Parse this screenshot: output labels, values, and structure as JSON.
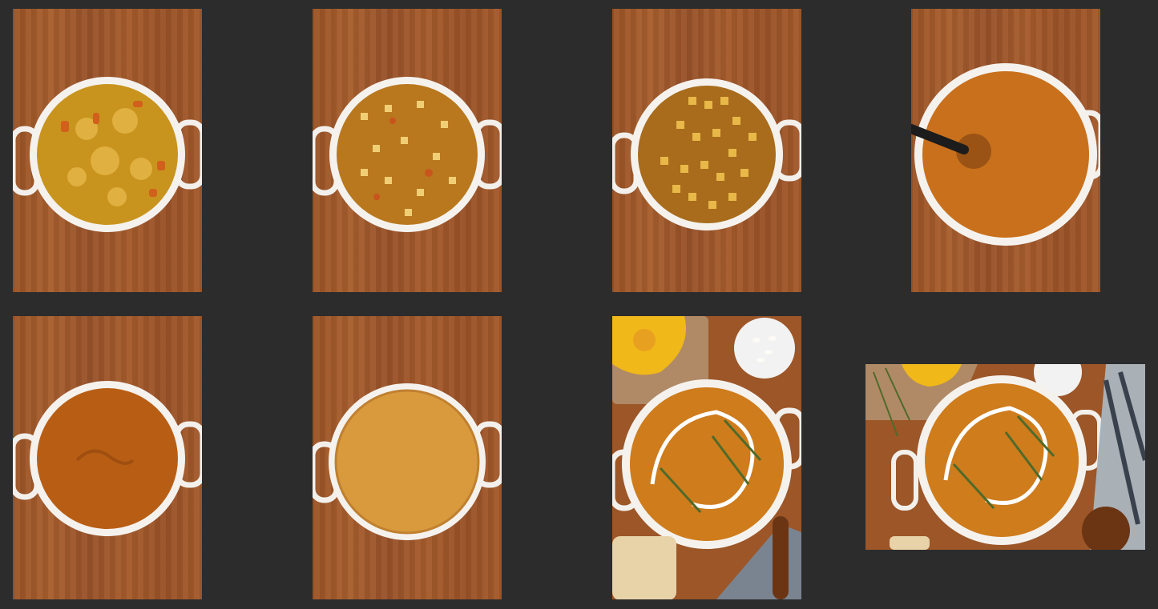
{
  "gallery": {
    "images": [
      {
        "step": "sauteed-vegetables",
        "soup_color": "#c8941e",
        "chunk_color": "#e0b040",
        "accent_color": "#d0601c"
      },
      {
        "step": "broth-with-squash-cubes",
        "soup_color": "#b9781e",
        "chunk_color": "#f0cf74",
        "accent_color": "#c9541c"
      },
      {
        "step": "simmered-squash-cubes",
        "soup_color": "#a86c1c",
        "chunk_color": "#e8b848",
        "accent_color": "#c05a1e"
      },
      {
        "step": "immersion-blender-puree",
        "soup_color": "#c9701c",
        "chunk_color": "",
        "accent_color": "#8a4a12"
      },
      {
        "step": "pureed-soup",
        "soup_color": "#b85e14",
        "chunk_color": "",
        "accent_color": "#a04e10"
      },
      {
        "step": "creamy-soup",
        "soup_color": "#d89a3c",
        "chunk_color": "",
        "accent_color": "#c08030"
      },
      {
        "step": "garnished-soup-portrait",
        "soup_color": "#cf7c1c",
        "chunk_color": "#ffffff",
        "accent_color": "#4f6a2a"
      },
      {
        "step": "garnished-soup-landscape",
        "soup_color": "#cf7c1c",
        "chunk_color": "#ffffff",
        "accent_color": "#4f6a2a"
      }
    ]
  }
}
